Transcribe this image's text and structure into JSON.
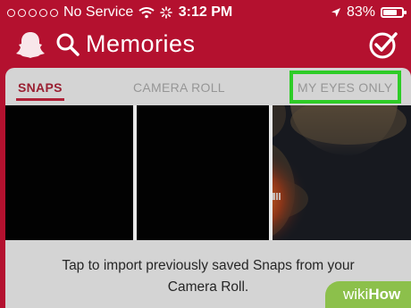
{
  "status_bar": {
    "carrier": "No Service",
    "time": "3:12 PM",
    "battery_percent": "83%",
    "battery_level": 0.83,
    "icons": [
      "signal-dots-icon",
      "wifi-icon",
      "loading-spinner-icon",
      "location-arrow-icon",
      "battery-icon"
    ]
  },
  "header": {
    "title": "Memories",
    "icons": [
      "snapchat-ghost-icon",
      "search-icon",
      "select-check-icon"
    ]
  },
  "tabs": [
    {
      "label": "SNAPS",
      "active": true
    },
    {
      "label": "CAMERA ROLL",
      "active": false
    },
    {
      "label": "MY EYES ONLY",
      "active": false,
      "highlighted": true
    }
  ],
  "thumbnails": [
    {
      "content": "black"
    },
    {
      "content": "black"
    },
    {
      "content": "dark photo with glowing text"
    }
  ],
  "import_message": {
    "line1": "Tap to import previously saved Snaps from your",
    "line2": "Camera Roll."
  },
  "watermark": {
    "prefix": "wiki",
    "suffix": "How"
  },
  "colors": {
    "header_bg": "#b4112f",
    "active_tab": "#9a2032",
    "highlight": "#2ecc27",
    "panel_bg": "#d4d4d4",
    "watermark_bg": "#8cc04b"
  }
}
